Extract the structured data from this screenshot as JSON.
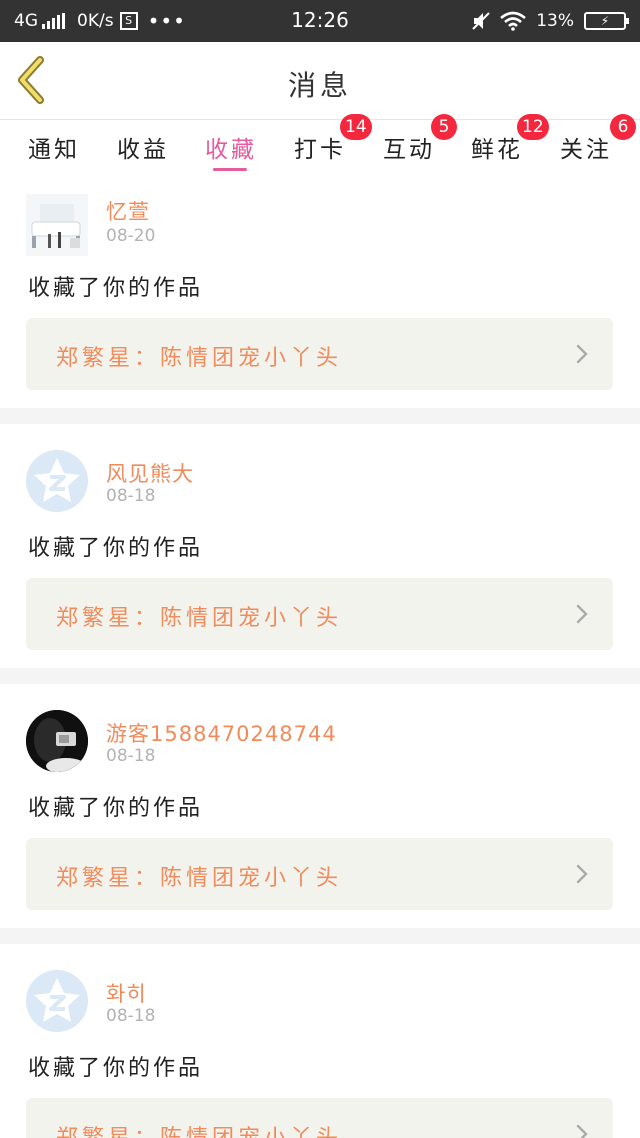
{
  "status_bar": {
    "network": "4G",
    "speed": "0K/s",
    "s_icon": "S",
    "more": "•••",
    "time": "12:26",
    "battery_percent": "13%"
  },
  "header": {
    "back_icon": "chevron-left-icon",
    "title": "消息"
  },
  "tabs": [
    {
      "label": "通知",
      "badge": ""
    },
    {
      "label": "收益",
      "badge": ""
    },
    {
      "label": "收藏",
      "badge": "",
      "active": true
    },
    {
      "label": "打卡",
      "badge": "14"
    },
    {
      "label": "互动",
      "badge": "5"
    },
    {
      "label": "鲜花",
      "badge": "12"
    },
    {
      "label": "关注",
      "badge": "6"
    }
  ],
  "messages": [
    {
      "user": "忆萱",
      "date": "08-20",
      "action": "收藏了你的作品",
      "work": "郑繁星：陈情团宠小丫头",
      "avatar": "photo-room"
    },
    {
      "user": "风见熊大",
      "date": "08-18",
      "action": "收藏了你的作品",
      "work": "郑繁星：陈情团宠小丫头",
      "avatar": "default"
    },
    {
      "user": "游客1588470248744",
      "date": "08-18",
      "action": "收藏了你的作品",
      "work": "郑繁星：陈情团宠小丫头",
      "avatar": "photo-dark"
    },
    {
      "user": "화히",
      "date": "08-18",
      "action": "收藏了你的作品",
      "work": "郑繁星：陈情团宠小丫头",
      "avatar": "default"
    }
  ],
  "colors": {
    "accent_pink": "#e45c9b",
    "name_orange": "#f08b5b",
    "badge_red": "#f3283e",
    "status_bar": "#333333"
  }
}
